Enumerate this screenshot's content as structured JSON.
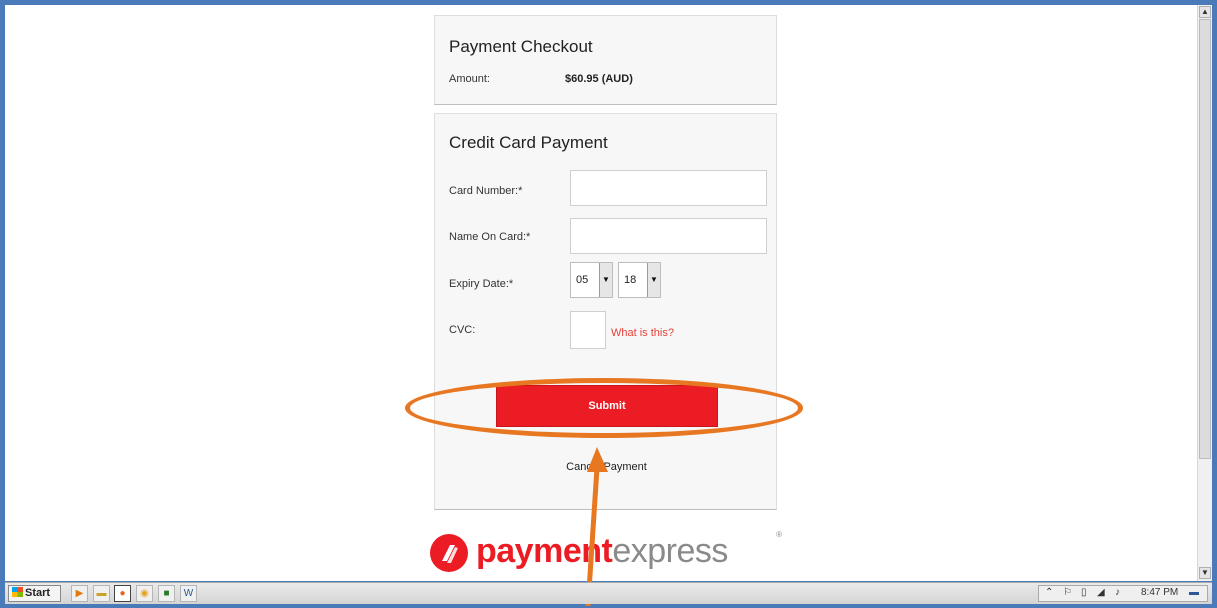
{
  "checkout": {
    "title": "Payment Checkout",
    "amount_label": "Amount:",
    "amount_value": "$60.95 (AUD)"
  },
  "credit_card": {
    "title": "Credit Card Payment",
    "card_number_label": "Card Number:*",
    "card_number_value": "",
    "name_label": "Name On Card:*",
    "name_value": "",
    "expiry_label": "Expiry Date:*",
    "expiry_month": "05",
    "expiry_year": "18",
    "cvc_label": "CVC:",
    "cvc_value": "",
    "cvc_help": "What is this?",
    "submit_label": "Submit",
    "cancel_label": "Cancel Payment"
  },
  "logo": {
    "part_a": "paym",
    "part_b": "nt",
    "part_c": "express",
    "reg": "®"
  },
  "taskbar": {
    "start_label": "Start",
    "clock": "8:47 PM"
  },
  "colors": {
    "accent_red": "#ec1c24",
    "annotation_orange": "#e87722",
    "link_red": "#e8413a"
  }
}
